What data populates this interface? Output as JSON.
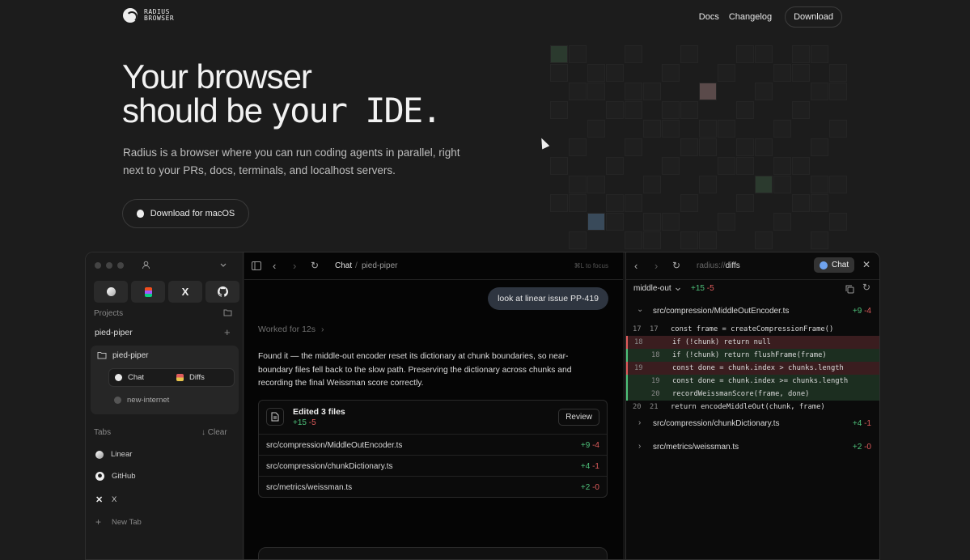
{
  "nav": {
    "logo_line1": "RADIUS",
    "logo_line2": "BROWSER",
    "docs": "Docs",
    "changelog": "Changelog",
    "download": "Download"
  },
  "hero": {
    "title_line1": "Your browser",
    "title_line2_a": "should be ",
    "title_line2_b": "your IDE.",
    "subtitle": "Radius is a browser where you can run coding agents in parallel, right next to your PRs, docs, terminals, and localhost servers.",
    "cta": "Download for macOS"
  },
  "sidebar": {
    "favorites": [
      {
        "icon": "linear-icon"
      },
      {
        "icon": "figma-icon"
      },
      {
        "icon": "x-icon",
        "glyph": "X"
      },
      {
        "icon": "github-icon"
      }
    ],
    "projects_label": "Projects",
    "project_group": "pied-piper",
    "project_card_title": "pied-piper",
    "chat_label": "Chat",
    "diffs_label": "Diffs",
    "other_item": "new-internet",
    "tabs_label": "Tabs",
    "clear_label": "↓ Clear",
    "tabs": [
      {
        "label": "Linear"
      },
      {
        "label": "GitHub"
      },
      {
        "label": "X"
      }
    ],
    "new_tab": "New Tab"
  },
  "chat": {
    "breadcrumb_1": "Chat",
    "breadcrumb_sep": "/",
    "breadcrumb_2": "pied-piper",
    "shortcut": "⌘L to focus",
    "user_message": "look at linear issue PP-419",
    "worked": "Worked for 12s",
    "reply": "Found it — the middle-out encoder reset its dictionary at chunk boundaries, so near-boundary files fell back to the slow path. Preserving the dictionary across chunks and recording the final Weissman score correctly.",
    "edit_title": "Edited 3 files",
    "edit_add": "+15",
    "edit_del": "-5",
    "review": "Review",
    "files": [
      {
        "name": "src/compression/MiddleOutEncoder.ts",
        "add": "+9",
        "del": "-4"
      },
      {
        "name": "src/compression/chunkDictionary.ts",
        "add": "+4",
        "del": "-1"
      },
      {
        "name": "src/metrics/weissman.ts",
        "add": "+2",
        "del": "-0"
      }
    ]
  },
  "diff": {
    "url_prefix": "radius://",
    "url_path": "diffs",
    "chat_btn": "Chat",
    "branch": "middle-out",
    "total_add": "+15",
    "total_del": "-5",
    "open_file": {
      "name": "src/compression/MiddleOutEncoder.ts",
      "add": "+9",
      "del": "-4"
    },
    "lines": [
      {
        "old": "17",
        "new": "17",
        "type": "ctx",
        "code": "const frame = createCompressionFrame()"
      },
      {
        "old": "18",
        "new": "",
        "type": "del",
        "code": "if (!chunk) return null"
      },
      {
        "old": "",
        "new": "18",
        "type": "add",
        "code": "if (!chunk) return flushFrame(frame)"
      },
      {
        "old": "19",
        "new": "",
        "type": "del",
        "code": "const done = chunk.index > chunks.length"
      },
      {
        "old": "",
        "new": "19",
        "type": "add",
        "code": "const done = chunk.index >= chunks.length"
      },
      {
        "old": "",
        "new": "20",
        "type": "add",
        "code": "recordWeissmanScore(frame, done)"
      },
      {
        "old": "20",
        "new": "21",
        "type": "ctx",
        "code": "return encodeMiddleOut(chunk, frame)"
      }
    ],
    "collapsed": [
      {
        "name": "src/compression/chunkDictionary.ts",
        "add": "+4",
        "del": "-1"
      },
      {
        "name": "src/metrics/weissman.ts",
        "add": "+2",
        "del": "-0"
      }
    ]
  },
  "colors": {
    "add": "#4ec17a",
    "del": "#e05c5c",
    "add_bg": "#1c2e20",
    "del_bg": "#3a1d1f",
    "user_bubble": "#2e3540"
  }
}
